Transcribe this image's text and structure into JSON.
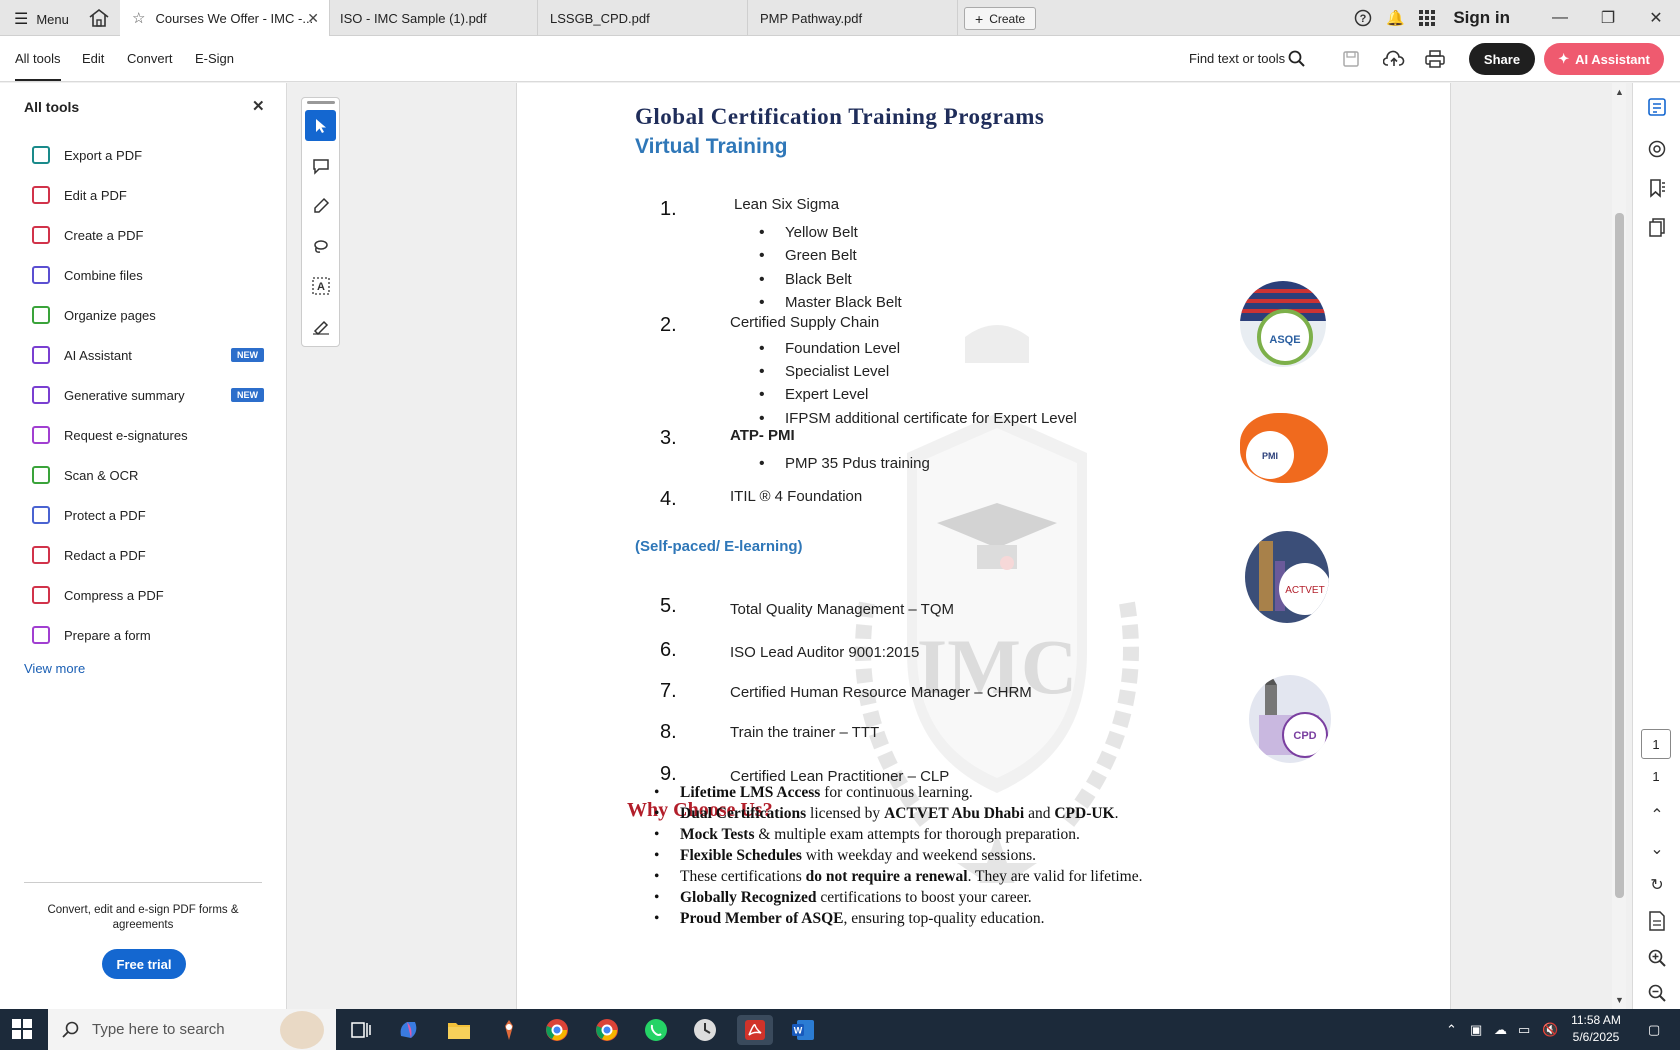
{
  "tabbar": {
    "menu_label": "Menu",
    "tabs": [
      {
        "label": "Courses We Offer - IMC -..."
      },
      {
        "label": "ISO - IMC Sample (1).pdf"
      },
      {
        "label": "LSSGB_CPD.pdf"
      },
      {
        "label": "PMP Pathway.pdf"
      }
    ],
    "create_label": "Create",
    "signin_label": "Sign in"
  },
  "toolbar": {
    "menus": [
      "All tools",
      "Edit",
      "Convert",
      "E-Sign"
    ],
    "find_label": "Find text or tools",
    "share_label": "Share",
    "ai_label": "AI Assistant"
  },
  "leftpanel": {
    "title": "All tools",
    "items": [
      {
        "label": "Export a PDF",
        "color": "#1a8a8a",
        "badge": ""
      },
      {
        "label": "Edit a PDF",
        "color": "#d1334a",
        "badge": ""
      },
      {
        "label": "Create a PDF",
        "color": "#d1334a",
        "badge": ""
      },
      {
        "label": "Combine files",
        "color": "#5b4fd1",
        "badge": ""
      },
      {
        "label": "Organize pages",
        "color": "#3aa33a",
        "badge": ""
      },
      {
        "label": "AI Assistant",
        "color": "#7a3fd1",
        "badge": "NEW"
      },
      {
        "label": "Generative summary",
        "color": "#7a3fd1",
        "badge": "NEW"
      },
      {
        "label": "Request e-signatures",
        "color": "#a13fd1",
        "badge": ""
      },
      {
        "label": "Scan & OCR",
        "color": "#3aa33a",
        "badge": ""
      },
      {
        "label": "Protect a PDF",
        "color": "#4a63d1",
        "badge": ""
      },
      {
        "label": "Redact a PDF",
        "color": "#d1334a",
        "badge": ""
      },
      {
        "label": "Compress a PDF",
        "color": "#d1334a",
        "badge": ""
      },
      {
        "label": "Prepare a form",
        "color": "#a13fd1",
        "badge": ""
      }
    ],
    "view_more": "View more",
    "promo": "Convert, edit and e-sign PDF forms & agreements",
    "trial_label": "Free trial"
  },
  "document": {
    "title": "Global Certification Training Programs",
    "subtitle": "Virtual Training",
    "programs": [
      {
        "num": "1.",
        "name": "Lean Six Sigma",
        "subs": [
          "Yellow Belt",
          "Green Belt",
          "Black Belt",
          "Master Black Belt"
        ]
      },
      {
        "num": "2.",
        "name": "Certified Supply Chain",
        "subs": [
          "Foundation Level",
          "Specialist Level",
          "Expert Level",
          "IFPSM additional certificate for Expert Level"
        ]
      },
      {
        "num": "3.",
        "name": "ATP- PMI",
        "subs": [
          "PMP 35 Pdus training"
        ]
      },
      {
        "num": "4.",
        "name": "ITIL  ® 4 Foundation",
        "subs": []
      }
    ],
    "selfpaced_heading": "(Self-paced/ E-learning)",
    "programs2": [
      {
        "num": "5.",
        "name": "Total Quality Management – TQM"
      },
      {
        "num": "6.",
        "name": "ISO Lead Auditor 9001:2015"
      },
      {
        "num": "7.",
        "name": "Certified Human Resource Manager – CHRM"
      },
      {
        "num": "8.",
        "name": "Train the trainer – TTT"
      },
      {
        "num": "9.",
        "name": "Certified Lean Practitioner – CLP"
      }
    ],
    "why_heading": "Why Choose Us?",
    "why_items": [
      {
        "bold": "Lifetime LMS Access",
        "rest": " for continuous learning."
      },
      {
        "bold": "Dual Certifications",
        "rest": " licensed by ",
        "bold2": "ACTVET Abu Dhabi",
        "rest2": " and ",
        "bold3": "CPD-UK",
        "rest3": "."
      },
      {
        "bold": "Mock Tests",
        "rest": " & multiple exam attempts for thorough preparation."
      },
      {
        "bold": "Flexible Schedules",
        "rest": " with weekday and weekend sessions."
      },
      {
        "bold": "",
        "rest": "These certifications ",
        "bold2": "do not require a renewal",
        "rest2": ". They are valid for lifetime."
      },
      {
        "bold": "Globally Recognized",
        "rest": " certifications to boost your career."
      },
      {
        "bold": "Proud Member of ASQE",
        "rest": ", ensuring top-quality education."
      }
    ],
    "watermark_text": "IMC",
    "logos": [
      {
        "name": "asqe-logo",
        "label": "ASQE"
      },
      {
        "name": "pmi-logo",
        "label": "PMI"
      },
      {
        "name": "actvet-logo",
        "label": "ACTVET"
      },
      {
        "name": "cpd-logo",
        "label": "CPD"
      }
    ]
  },
  "rightrail": {
    "page_current": "1",
    "page_total": "1"
  },
  "taskbar": {
    "search_placeholder": "Type here to search",
    "time": "11:58 AM",
    "date": "5/6/2025"
  }
}
